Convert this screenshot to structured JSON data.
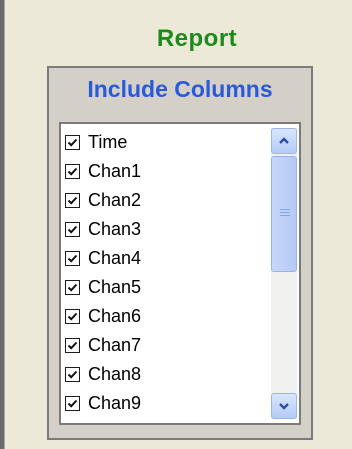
{
  "report": {
    "title": "Report",
    "group_title": "Include Columns",
    "columns": [
      {
        "label": "Time",
        "checked": true
      },
      {
        "label": "Chan1",
        "checked": true
      },
      {
        "label": "Chan2",
        "checked": true
      },
      {
        "label": "Chan3",
        "checked": true
      },
      {
        "label": "Chan4",
        "checked": true
      },
      {
        "label": "Chan5",
        "checked": true
      },
      {
        "label": "Chan6",
        "checked": true
      },
      {
        "label": "Chan7",
        "checked": true
      },
      {
        "label": "Chan8",
        "checked": true
      },
      {
        "label": "Chan9",
        "checked": true
      }
    ]
  },
  "colors": {
    "title": "#1d8a1d",
    "group_title": "#2a5ad8"
  }
}
